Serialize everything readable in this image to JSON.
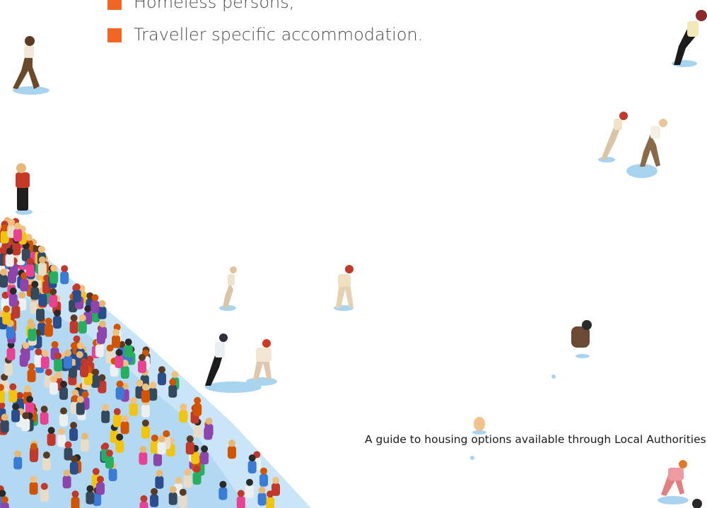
{
  "bullets": [
    {
      "text": "Homeless persons,"
    },
    {
      "text": "Traveller specific accommodation."
    }
  ],
  "footer": {
    "text": "A guide to housing options available through Local Authorities"
  },
  "colors": {
    "bullet_accent": "#f26522",
    "text": "#4a4a4a",
    "shadow": "#a9d4f0"
  },
  "illustration": {
    "name": "crowd of people viewed from above"
  }
}
